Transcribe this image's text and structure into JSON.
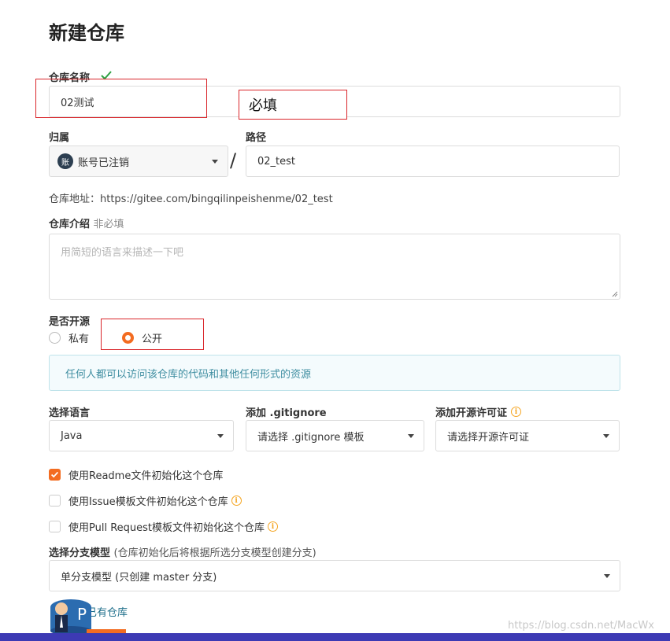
{
  "page": {
    "title": "新建仓库"
  },
  "repo_name": {
    "label": "仓库名称",
    "value": "02测试",
    "annotation": "必填"
  },
  "owner": {
    "label": "归属",
    "avatar_char": "账",
    "value": "账号已注销"
  },
  "path": {
    "label": "路径",
    "separator": "/",
    "value": "02_test"
  },
  "address": {
    "text": "仓库地址：https://gitee.com/bingqilinpeishenme/02_test"
  },
  "intro": {
    "label": "仓库介绍",
    "optional": "非必填",
    "placeholder": "用简短的语言来描述一下吧"
  },
  "visibility": {
    "label": "是否开源",
    "options": [
      "私有",
      "公开"
    ],
    "selected": "公开",
    "notice": "任何人都可以访问该仓库的代码和其他任何形式的资源"
  },
  "language": {
    "label": "选择语言",
    "value": "Java"
  },
  "gitignore": {
    "label": "添加 .gitignore",
    "value": "请选择 .gitignore 模板"
  },
  "license": {
    "label": "添加开源许可证",
    "value": "请选择开源许可证"
  },
  "init_options": [
    {
      "label": "使用Readme文件初始化这个仓库",
      "checked": true
    },
    {
      "label": "使用Issue模板文件初始化这个仓库",
      "checked": false
    },
    {
      "label": "使用Pull Request模板文件初始化这个仓库",
      "checked": false
    }
  ],
  "branch": {
    "label": "选择分支模型",
    "hint": "(仓库初始化后将根据所选分支模型创建分支)",
    "value": "单分支模型 (只创建 master 分支)"
  },
  "import_link": "已有仓库",
  "watermark": "https://blog.csdn.net/MacWx",
  "colors": {
    "accent": "#f36c21",
    "error": "#d9262b",
    "success": "#2ea043",
    "notice_text": "#3f8ea1"
  }
}
